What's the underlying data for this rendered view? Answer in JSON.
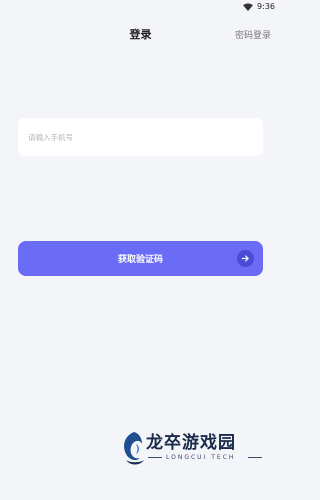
{
  "status_bar": {
    "time": "9:36",
    "wifi_icon": "wifi-icon"
  },
  "header": {
    "title": "登录",
    "password_login": "密码登录"
  },
  "phone_input": {
    "placeholder": "请输入手机号",
    "value": ""
  },
  "get_code_button": {
    "label": "获取验证码",
    "icon": "arrow-right-icon"
  },
  "colors": {
    "background": "#f4f5f9",
    "accent": "#6b6cf5",
    "accent_dark": "#4a4bd6"
  },
  "watermark": {
    "name": "龙卒游戏园",
    "subtitle": "LONGCUI TECH"
  }
}
